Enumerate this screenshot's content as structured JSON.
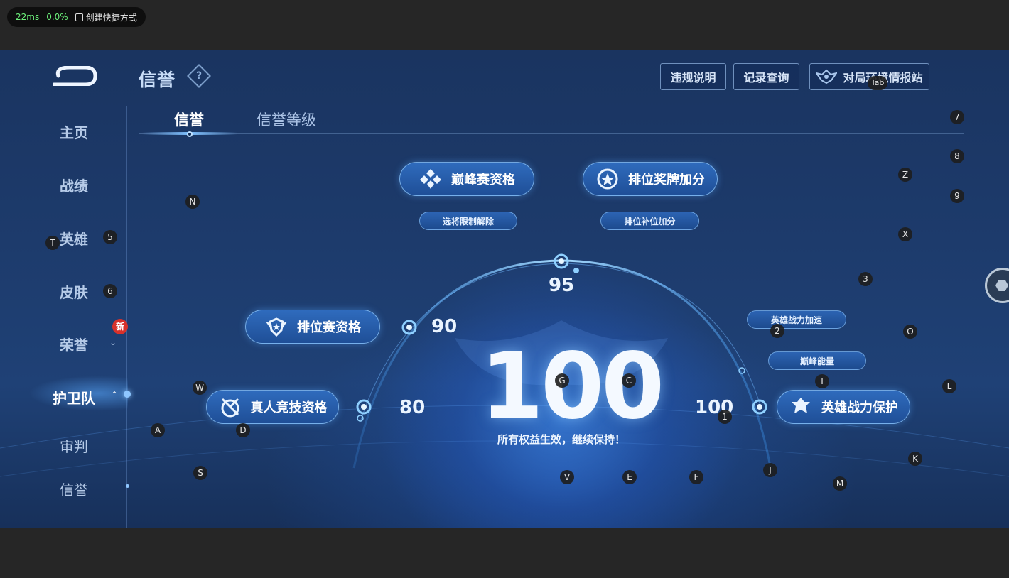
{
  "overlay": {
    "latency": "22ms",
    "loss": "0.0%",
    "shortcut": "创建快捷方式"
  },
  "header": {
    "title": "信誉",
    "help": "?",
    "buttons": [
      "违规说明",
      "记录查询",
      "对局环境情报站"
    ]
  },
  "sidebar": {
    "items": [
      "主页",
      "战绩",
      "英雄",
      "皮肤",
      "荣誉",
      "护卫队",
      "审判",
      "信誉"
    ],
    "badge": "新",
    "active_index": 5
  },
  "tabs": [
    "信誉",
    "信誉等级"
  ],
  "main": {
    "score": "100",
    "subtitle": "所有权益生效，继续保持！",
    "ticks": [
      "80",
      "90",
      "95",
      "100"
    ],
    "big_buttons": [
      "巅峰赛资格",
      "排位奖牌加分",
      "排位赛资格",
      "真人竞技资格",
      "英雄战力保护"
    ],
    "small_buttons": [
      "选将限制解除",
      "排位补位加分",
      "英雄战力加速",
      "巅峰能量"
    ]
  },
  "keys": [
    "Tab",
    "7",
    "8",
    "Z",
    "9",
    "X",
    "N",
    "T",
    "5",
    "6",
    "3",
    "2",
    "O",
    "I",
    "W",
    "G",
    "C",
    "L",
    "A",
    "D",
    "1",
    "S",
    "V",
    "E",
    "F",
    "J",
    "K",
    "M"
  ],
  "colors": {
    "accent": "#7fc0ff",
    "badge": "#d8312a",
    "background": "#1d3b6c"
  }
}
